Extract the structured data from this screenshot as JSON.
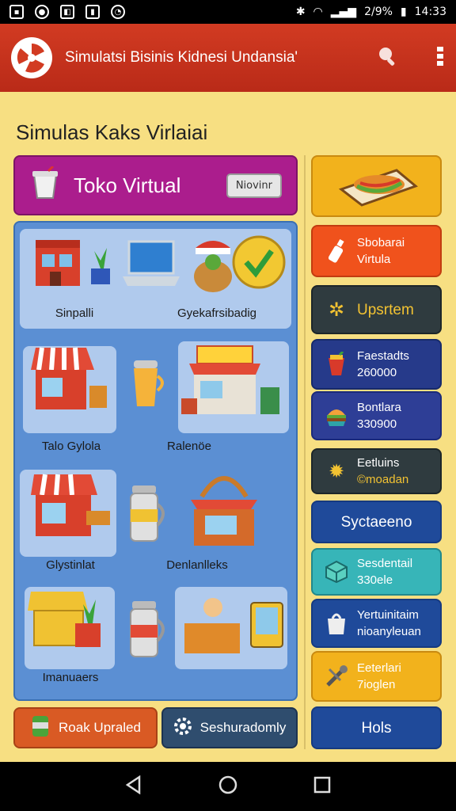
{
  "status": {
    "battery": "2/9%",
    "time": "14:33"
  },
  "appbar": {
    "title": "Simulatsi Bisinis  Kidnesi Undansia'"
  },
  "page": {
    "title": "Simulas Kaks Virlaiai"
  },
  "toko": {
    "title": "Toko Virtual",
    "button": "Niovinr"
  },
  "grid": {
    "labels": [
      "Sinpalli",
      "Gyekafrsibadig",
      "Talo Gylola",
      "Ralenöe",
      "Glystinlat",
      "Denlanlleks",
      "Imanuaers"
    ]
  },
  "bottom": {
    "left": "Roak Upraled",
    "right": "Seshuradomly"
  },
  "side": [
    {
      "line1": "Sbobarai",
      "line2": "Virtula"
    },
    {
      "line1": "Upsrtem",
      "line2": ""
    },
    {
      "line1": "Faestadts",
      "line2": "260000"
    },
    {
      "line1": "Bontlara",
      "line2": "330900"
    },
    {
      "line1": "Eetluins",
      "line2": "©moadan"
    },
    {
      "line1": "Syctaeeno",
      "line2": ""
    },
    {
      "line1": "Sesdentail",
      "line2": "330ele"
    },
    {
      "line1": "Yertuinitaim",
      "line2": "nioanyleuan"
    },
    {
      "line1": "Eeterlari",
      "line2": "7ioglen"
    },
    {
      "line1": "Hols",
      "line2": ""
    }
  ],
  "colors": {
    "appbar": "#c93220",
    "page_bg": "#f7df82",
    "toko": "#ab1d8d",
    "grid": "#5b8fd3"
  }
}
